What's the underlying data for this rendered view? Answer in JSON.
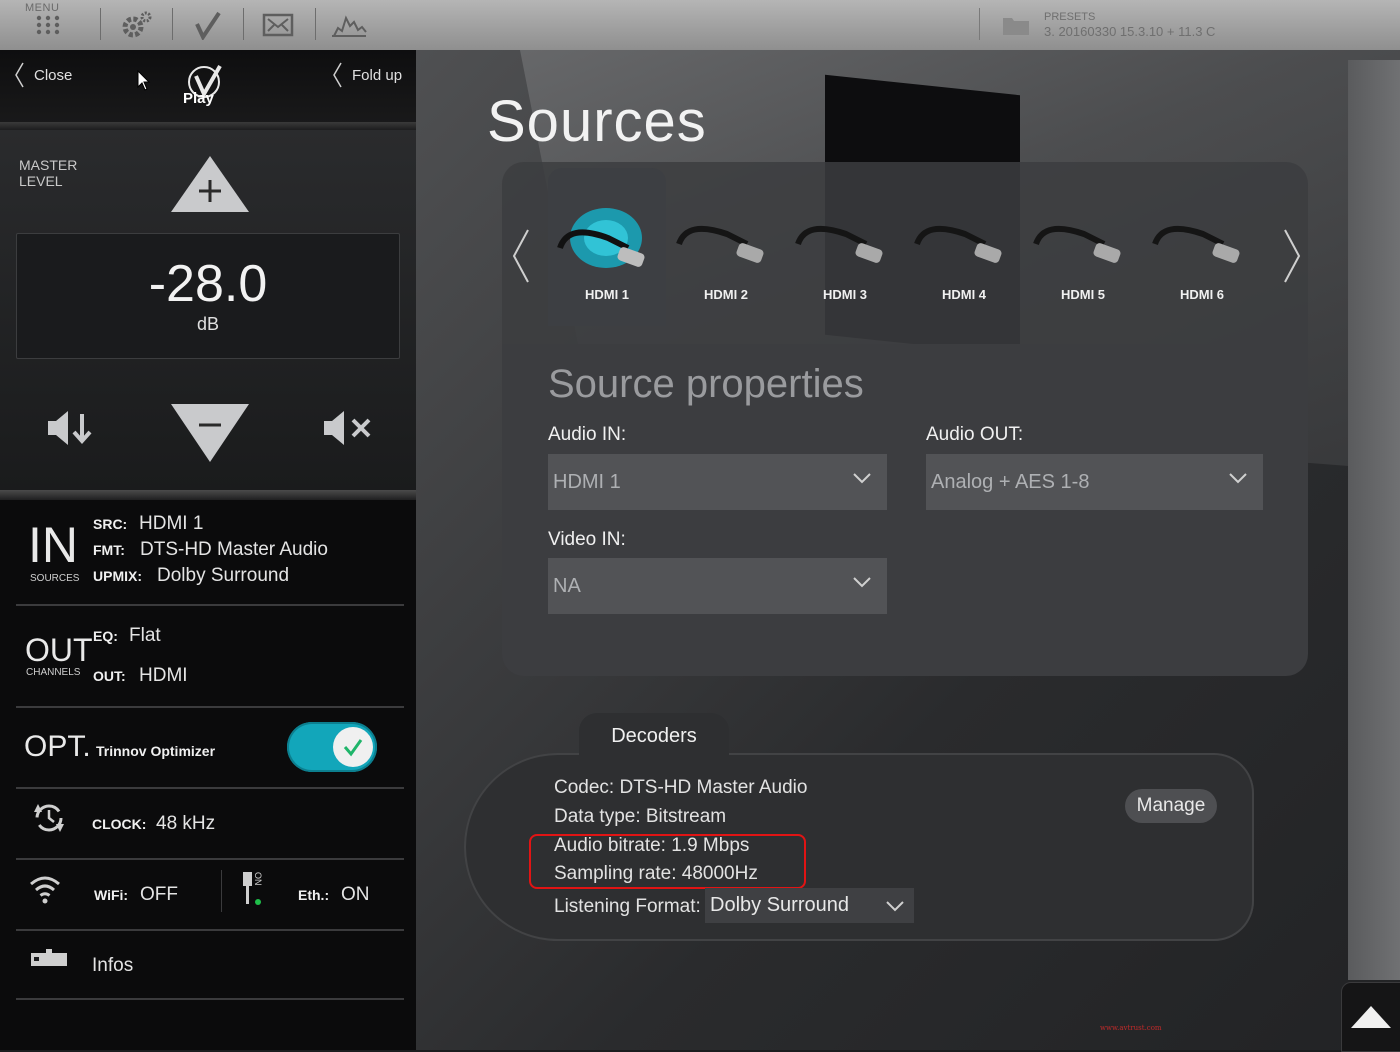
{
  "topbar": {
    "menu_label": "MENU",
    "presets_label": "PRESETS",
    "presets_value": "3. 20160330 15.3.10 + 11.3 C",
    "icons": [
      "menu-grid-icon",
      "settings-icon",
      "check-icon",
      "display-icon",
      "graph-icon",
      "folder-icon"
    ]
  },
  "left": {
    "close_label": "Close",
    "fold_label": "Fold up",
    "play_label": "Play",
    "master_level_line1": "MASTER",
    "master_level_line2": "LEVEL",
    "volume_value": "-28.0",
    "volume_unit": "dB",
    "in_big": "IN",
    "in_sub": "SOURCES",
    "src_key": "SRC:",
    "src_val": "HDMI 1",
    "fmt_key": "FMT:",
    "fmt_val": "DTS-HD Master Audio",
    "upmix_key": "UPMIX:",
    "upmix_val": "Dolby Surround",
    "out_big": "OUT",
    "out_sub": "CHANNELS",
    "eq_key": "EQ:",
    "eq_val": "Flat",
    "out_key": "OUT:",
    "out_val": "HDMI",
    "opt_big": "OPT.",
    "opt_label": "Trinnov Optimizer",
    "opt_enabled": true,
    "clock_key": "CLOCK:",
    "clock_val": "48 kHz",
    "wifi_key": "WiFi:",
    "wifi_val": "OFF",
    "eth_key": "Eth.:",
    "eth_val": "ON",
    "eth_icon_text": "ON",
    "infos_label": "Infos"
  },
  "main": {
    "title": "Sources",
    "sources": [
      "HDMI 1",
      "HDMI 2",
      "HDMI 3",
      "HDMI 4",
      "HDMI 5",
      "HDMI 6"
    ],
    "selected_source": "HDMI 1",
    "props_title": "Source properties",
    "audio_in_label": "Audio IN:",
    "audio_in_value": "HDMI 1",
    "audio_out_label": "Audio OUT:",
    "audio_out_value": "Analog + AES 1-8",
    "video_in_label": "Video IN:",
    "video_in_value": "NA"
  },
  "decoders": {
    "tab_label": "Decoders",
    "codec": "Codec: DTS-HD Master Audio",
    "data_type": "Data type: Bitstream",
    "bitrate": "Audio bitrate: 1.9 Mbps",
    "sampling": "Sampling rate: 48000Hz",
    "listening_label": "Listening Format:",
    "listening_value": "Dolby Surround",
    "manage_label": "Manage"
  },
  "watermark": "www.avtrust.com",
  "colors": {
    "accent": "#12a6ba",
    "highlight": "#e11414"
  }
}
